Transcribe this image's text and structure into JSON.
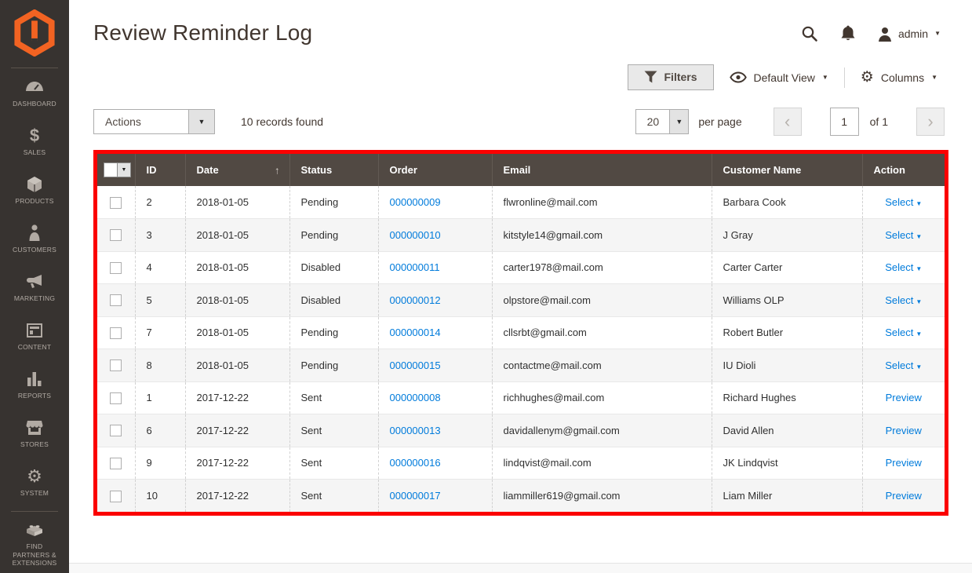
{
  "header": {
    "title": "Review Reminder Log",
    "user_name": "admin"
  },
  "sidebar": {
    "items": [
      {
        "icon": "dashboard-icon",
        "label": "DASHBOARD"
      },
      {
        "icon": "sales-icon",
        "label": "SALES"
      },
      {
        "icon": "products-icon",
        "label": "PRODUCTS"
      },
      {
        "icon": "customers-icon",
        "label": "CUSTOMERS"
      },
      {
        "icon": "marketing-icon",
        "label": "MARKETING"
      },
      {
        "icon": "content-icon",
        "label": "CONTENT"
      },
      {
        "icon": "reports-icon",
        "label": "REPORTS"
      },
      {
        "icon": "stores-icon",
        "label": "STORES"
      },
      {
        "icon": "system-icon",
        "label": "SYSTEM"
      },
      {
        "icon": "extensions-icon",
        "label": "FIND PARTNERS & EXTENSIONS"
      }
    ]
  },
  "grid_toolbar": {
    "filters_label": "Filters",
    "view_label": "Default View",
    "columns_label": "Columns"
  },
  "controls": {
    "actions_label": "Actions",
    "records_found": "10 records found",
    "per_page_value": "20",
    "per_page_label": "per page",
    "current_page": "1",
    "total_pages_label": "of 1"
  },
  "icons": {
    "caret_down": "▼",
    "sort_asc": "↑",
    "gear": "⚙",
    "prev_chevron": "‹",
    "next_chevron": "›"
  },
  "table": {
    "columns": [
      "ID",
      "Date",
      "Status",
      "Order",
      "Email",
      "Customer Name",
      "Action"
    ],
    "sorted_column": "Date",
    "sort_direction": "asc",
    "rows": [
      {
        "id": "2",
        "date": "2018-01-05",
        "status": "Pending",
        "order": "000000009",
        "email": "flwronline@mail.com",
        "customer": "Barbara Cook",
        "action": "Select",
        "action_type": "dropdown"
      },
      {
        "id": "3",
        "date": "2018-01-05",
        "status": "Pending",
        "order": "000000010",
        "email": "kitstyle14@gmail.com",
        "customer": "J Gray",
        "action": "Select",
        "action_type": "dropdown"
      },
      {
        "id": "4",
        "date": "2018-01-05",
        "status": "Disabled",
        "order": "000000011",
        "email": "carter1978@mail.com",
        "customer": "Carter Carter",
        "action": "Select",
        "action_type": "dropdown"
      },
      {
        "id": "5",
        "date": "2018-01-05",
        "status": "Disabled",
        "order": "000000012",
        "email": "olpstore@mail.com",
        "customer": "Williams OLP",
        "action": "Select",
        "action_type": "dropdown"
      },
      {
        "id": "7",
        "date": "2018-01-05",
        "status": "Pending",
        "order": "000000014",
        "email": "cllsrbt@gmail.com",
        "customer": "Robert Butler",
        "action": "Select",
        "action_type": "dropdown"
      },
      {
        "id": "8",
        "date": "2018-01-05",
        "status": "Pending",
        "order": "000000015",
        "email": "contactme@mail.com",
        "customer": "IU Dioli",
        "action": "Select",
        "action_type": "dropdown"
      },
      {
        "id": "1",
        "date": "2017-12-22",
        "status": "Sent",
        "order": "000000008",
        "email": "richhughes@mail.com",
        "customer": "Richard Hughes",
        "action": "Preview",
        "action_type": "link"
      },
      {
        "id": "6",
        "date": "2017-12-22",
        "status": "Sent",
        "order": "000000013",
        "email": "davidallenym@gmail.com",
        "customer": "David Allen",
        "action": "Preview",
        "action_type": "link"
      },
      {
        "id": "9",
        "date": "2017-12-22",
        "status": "Sent",
        "order": "000000016",
        "email": "lindqvist@mail.com",
        "customer": "JK Lindqvist",
        "action": "Preview",
        "action_type": "link"
      },
      {
        "id": "10",
        "date": "2017-12-22",
        "status": "Sent",
        "order": "000000017",
        "email": "liammiller619@gmail.com",
        "customer": "Liam Miller",
        "action": "Preview",
        "action_type": "link"
      }
    ]
  },
  "colors": {
    "sidebar_bg": "#373330",
    "logo_orange": "#f26322",
    "table_header_bg": "#514943",
    "link_blue": "#007bdb",
    "highlight_border_red": "#fb0000",
    "row_alt_bg": "#f5f5f5",
    "text_dark": "#41362f"
  }
}
